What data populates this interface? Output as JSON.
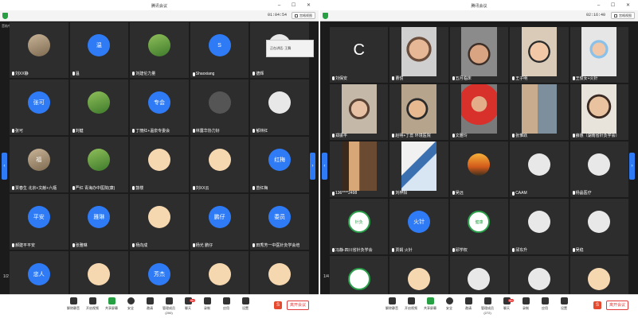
{
  "left": {
    "title": "腾讯会议",
    "clock": "01:04:54",
    "gallery_label": "宫格视图",
    "corner": "音轨中",
    "overlay_label": "正在讲话: 王舞",
    "page_indicator": "1/2",
    "tiles": [
      {
        "name": "刘XX静",
        "avatar": "photo",
        "text": ""
      },
      {
        "name": "温",
        "avatar": "blue",
        "text": "温"
      },
      {
        "name": "刘建伦力量",
        "avatar": "green",
        "text": ""
      },
      {
        "name": "Shaoxiang",
        "avatar": "blue",
        "text": "S"
      },
      {
        "name": "德辉",
        "avatar": "white",
        "text": ""
      },
      {
        "name": "张可",
        "avatar": "blue",
        "text": "张可"
      },
      {
        "name": "刘健",
        "avatar": "green",
        "text": ""
      },
      {
        "name": "丁丽红+温泉专委会",
        "avatar": "blue",
        "text": "专会"
      },
      {
        "name": "林露华协力好",
        "avatar": "dark",
        "text": ""
      },
      {
        "name": "郁林红",
        "avatar": "white",
        "text": ""
      },
      {
        "name": "贾春生 北京+文献+六瓶",
        "avatar": "photo",
        "text": "福"
      },
      {
        "name": "严红 青海办中医院(康)",
        "avatar": "green",
        "text": ""
      },
      {
        "name": "鼓楼",
        "avatar": "cartoon",
        "text": ""
      },
      {
        "name": "刘XX云",
        "avatar": "cartoon",
        "text": ""
      },
      {
        "name": "曾红梅",
        "avatar": "blue",
        "text": "红梅"
      },
      {
        "name": "郝建平平安",
        "avatar": "blue",
        "text": "平安"
      },
      {
        "name": "张雅琳",
        "avatar": "blue",
        "text": "雅琳"
      },
      {
        "name": "杨向成",
        "avatar": "cartoon",
        "text": ""
      },
      {
        "name": "杨光 鹏仔",
        "avatar": "blue",
        "text": "鹏仔"
      },
      {
        "name": "田秀芳一中医针灸学会培",
        "avatar": "blue",
        "text": "委员"
      },
      {
        "name": "",
        "avatar": "blue",
        "text": "忠人"
      },
      {
        "name": "",
        "avatar": "cartoon",
        "text": ""
      },
      {
        "name": "",
        "avatar": "blue",
        "text": "芳杰"
      },
      {
        "name": "",
        "avatar": "cartoon",
        "text": ""
      },
      {
        "name": "",
        "avatar": "cartoon",
        "text": ""
      }
    ],
    "toolbar": [
      {
        "label": "解除静音"
      },
      {
        "label": "开启视频"
      },
      {
        "label": "共享屏幕"
      },
      {
        "label": "安全"
      },
      {
        "label": "邀请"
      },
      {
        "label": "管理成员(200)"
      },
      {
        "label": "聊天"
      },
      {
        "label": "录制"
      },
      {
        "label": "应用"
      },
      {
        "label": "设置"
      }
    ],
    "chat_badge": "99+",
    "end_label": "离开会议"
  },
  "right": {
    "title": "腾讯会议",
    "clock": "02:16:40",
    "gallery_label": "宫格视图",
    "corner": "音轨中",
    "page_indicator": "1/4",
    "tiles": [
      {
        "name": "刘保安",
        "kind": "C",
        "text": "C"
      },
      {
        "name": "曹悦",
        "kind": "face1"
      },
      {
        "name": "五月临床",
        "kind": "face3"
      },
      {
        "name": "王子明",
        "kind": "child"
      },
      {
        "name": "王俊女+火针",
        "kind": "mask"
      },
      {
        "name": "郑振平",
        "kind": "face2"
      },
      {
        "name": "赵明+丁蕊 环境医院",
        "kind": "face4"
      },
      {
        "name": "文雅玲",
        "kind": "red"
      },
      {
        "name": "张惟跃",
        "kind": "pair"
      },
      {
        "name": "薛惠（湖南省针灸学会）",
        "kind": "face5"
      },
      {
        "name": "136****2498",
        "kind": "library"
      },
      {
        "name": "刘梓阳",
        "kind": "poster"
      },
      {
        "name": "吴远",
        "avatar": "sunset"
      },
      {
        "name": "CAAM",
        "avatar": "white"
      },
      {
        "name": "杨晶医疗",
        "avatar": "white"
      },
      {
        "name": "冯静-四川省针灸学会",
        "avatar": "logo",
        "text": "针灸"
      },
      {
        "name": "贾娟 火针",
        "avatar": "blue",
        "text": "火针"
      },
      {
        "name": "邱学权",
        "avatar": "logo",
        "text": "健康"
      },
      {
        "name": "邱东升",
        "avatar": "white"
      },
      {
        "name": "吴稳",
        "avatar": "white"
      },
      {
        "name": "",
        "avatar": "logo",
        "text": ""
      },
      {
        "name": "",
        "avatar": "cartoon"
      },
      {
        "name": "",
        "avatar": "white"
      },
      {
        "name": "",
        "avatar": "white"
      },
      {
        "name": "",
        "avatar": "cartoon"
      }
    ],
    "toolbar": [
      {
        "label": "解除静音"
      },
      {
        "label": "开启视频"
      },
      {
        "label": "共享屏幕"
      },
      {
        "label": "安全"
      },
      {
        "label": "邀请"
      },
      {
        "label": "管理成员(272)"
      },
      {
        "label": "聊天"
      },
      {
        "label": "录制"
      },
      {
        "label": "应用"
      },
      {
        "label": "设置"
      }
    ],
    "chat_badge": "99+",
    "end_label": "离开会议"
  }
}
